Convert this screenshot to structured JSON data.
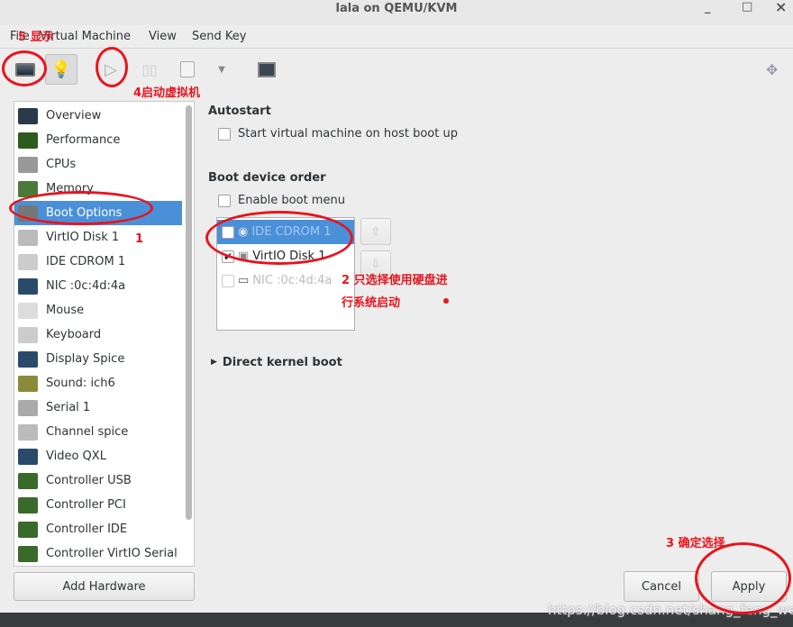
{
  "window": {
    "title": "lala on QEMU/KVM",
    "controls": [
      "_",
      "□",
      "×"
    ]
  },
  "menu": [
    "File",
    "Virtual Machine",
    "View",
    "Send Key"
  ],
  "sidebar": {
    "items": [
      "Overview",
      "Performance",
      "CPUs",
      "Memory",
      "Boot Options",
      "VirtIO Disk 1",
      "IDE CDROM 1",
      "NIC :0c:4d:4a",
      "Mouse",
      "Keyboard",
      "Display Spice",
      "Sound: ich6",
      "Serial 1",
      "Channel spice",
      "Video QXL",
      "Controller USB",
      "Controller PCI",
      "Controller IDE",
      "Controller VirtIO Serial"
    ],
    "selected": "Boot Options",
    "add_hardware": "Add Hardware"
  },
  "main": {
    "autostart_heading": "Autostart",
    "autostart_label": "Start virtual machine on host boot up",
    "autostart_checked": false,
    "boot_heading": "Boot device order",
    "boot_menu_label": "Enable boot menu",
    "boot_menu_checked": false,
    "boot_devices": [
      {
        "label": "IDE CDROM 1",
        "checked": false
      },
      {
        "label": "VirtIO Disk 1",
        "checked": true
      },
      {
        "label": "NIC :0c:4d:4a",
        "checked": false
      }
    ],
    "direct_kernel": "Direct kernel boot"
  },
  "buttons": {
    "cancel": "Cancel",
    "apply": "Apply"
  },
  "annotations": {
    "a1": "1",
    "a2": "2 只选择使用硬盘进",
    "a2b": "行系统启动",
    "a3": "3 确定选择",
    "a4": "4启动虚拟机",
    "a5": "5 显示"
  },
  "watermark": "https://blog.csdn.net/shang_feng_wei",
  "colors": {
    "selection": "#4a90d9",
    "annotation": "#e8141e"
  }
}
